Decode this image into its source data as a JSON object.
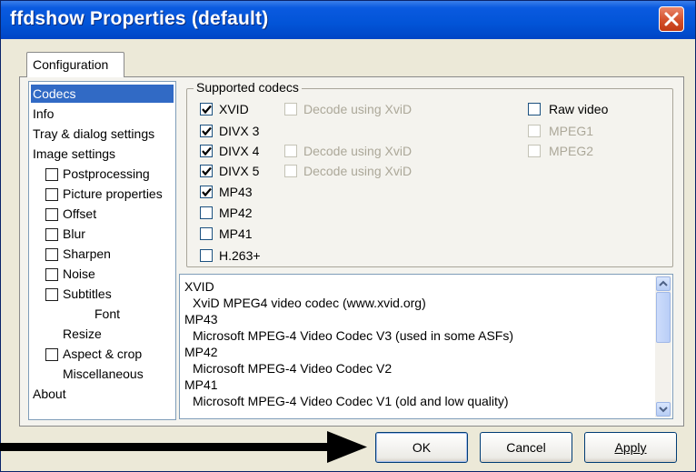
{
  "window": {
    "title": "ffdshow Properties (default)",
    "close_icon": "close-icon"
  },
  "tabs": [
    {
      "label": "Configuration",
      "selected": true
    }
  ],
  "nav": {
    "items": [
      {
        "label": "Codecs",
        "selected": true,
        "checkbox": false
      },
      {
        "label": "Info",
        "checkbox": false
      },
      {
        "label": "Tray & dialog settings",
        "checkbox": false
      },
      {
        "label": "Image settings",
        "checkbox": false
      },
      {
        "label": "Postprocessing",
        "checkbox": true,
        "checked": false
      },
      {
        "label": "Picture properties",
        "checkbox": true,
        "checked": false
      },
      {
        "label": "Offset",
        "checkbox": true,
        "checked": false
      },
      {
        "label": "Blur",
        "checkbox": true,
        "checked": false
      },
      {
        "label": "Sharpen",
        "checkbox": true,
        "checked": false
      },
      {
        "label": "Noise",
        "checkbox": true,
        "checked": false
      },
      {
        "label": "Subtitles",
        "checkbox": true,
        "checked": false
      },
      {
        "label": "Font",
        "checkbox": false
      },
      {
        "label": "Resize",
        "checkbox": false
      },
      {
        "label": "Aspect & crop",
        "checkbox": true,
        "checked": false
      },
      {
        "label": "Miscellaneous",
        "checkbox": false
      },
      {
        "label": "About",
        "checkbox": false
      }
    ]
  },
  "codecs": {
    "group_label": "Supported codecs",
    "left": [
      {
        "label": "XVID",
        "checked": true
      },
      {
        "label": "DIVX 3",
        "checked": true
      },
      {
        "label": "DIVX 4",
        "checked": true
      },
      {
        "label": "DIVX 5",
        "checked": true
      },
      {
        "label": "MP43",
        "checked": true
      },
      {
        "label": "MP42",
        "checked": false
      },
      {
        "label": "MP41",
        "checked": false
      },
      {
        "label": "H.263+",
        "checked": false
      }
    ],
    "decode": [
      {
        "label": "Decode using XviD",
        "checked": false,
        "disabled": true
      },
      {
        "label": "Decode using XviD",
        "checked": false,
        "disabled": true
      },
      {
        "label": "Decode using XviD",
        "checked": false,
        "disabled": true
      }
    ],
    "right": [
      {
        "label": "Raw video",
        "checked": false,
        "disabled": false
      },
      {
        "label": "MPEG1",
        "checked": false,
        "disabled": true
      },
      {
        "label": "MPEG2",
        "checked": false,
        "disabled": true
      }
    ]
  },
  "description": {
    "lines": [
      "XVID",
      "XviD MPEG4 video codec (www.xvid.org)",
      "MP43",
      "Microsoft MPEG-4 Video Codec V3 (used in some ASFs)",
      "MP42",
      "Microsoft MPEG-4 Video Codec V2",
      "MP41",
      "Microsoft MPEG-4 Video Codec V1 (old and low quality)"
    ]
  },
  "buttons": {
    "ok": "OK",
    "cancel": "Cancel",
    "apply": "Apply"
  },
  "colors": {
    "titlebar": "#0254d7",
    "selection": "#316ac5",
    "close_button": "#d4502b"
  }
}
